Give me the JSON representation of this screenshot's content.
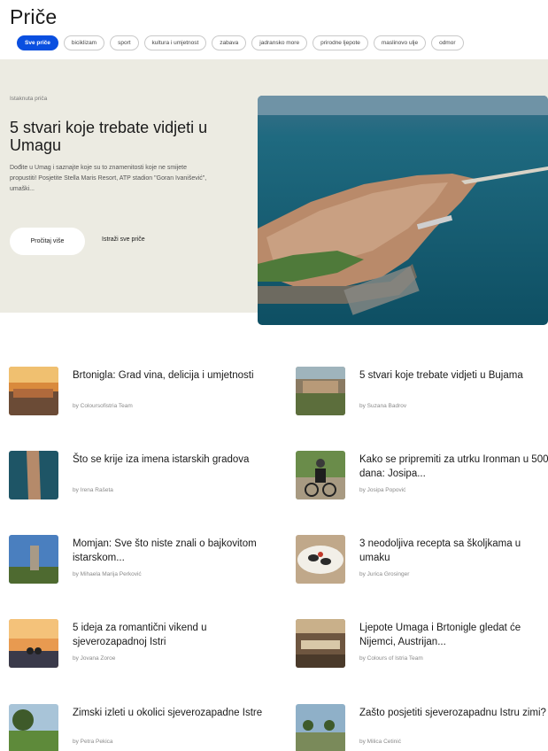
{
  "page": {
    "title": "Priče"
  },
  "filters": [
    {
      "label": "Sve priče",
      "active": true
    },
    {
      "label": "biciklizam",
      "active": false
    },
    {
      "label": "sport",
      "active": false
    },
    {
      "label": "kultura i umjetnost",
      "active": false
    },
    {
      "label": "zabava",
      "active": false
    },
    {
      "label": "jadransko more",
      "active": false
    },
    {
      "label": "prirodne ljepote",
      "active": false
    },
    {
      "label": "maslinovo ulje",
      "active": false
    },
    {
      "label": "odmor",
      "active": false
    }
  ],
  "featured": {
    "kicker": "Istaknuta priča",
    "title": "5 stvari koje trebate vidjeti u Umagu",
    "description": "Dođite u Umag i saznajte koje su to znamenitosti koje ne smijete propustiti! Posjetite Stella Maris Resort, ATP stadion \"Goran Ivanišević\", umaški...",
    "read_more": "Pročitaj više",
    "explore_all": "Istraži sve priče"
  },
  "stories": [
    {
      "title": "Brtonigla: Grad vina, delicija i umjetnosti",
      "author": "by Coloursofistria Team",
      "thumb": "sunset-town"
    },
    {
      "title": "5 stvari koje trebate vidjeti u Bujama",
      "author": "by Suzana Badrov",
      "thumb": "aerial-town"
    },
    {
      "title": "Što se krije iza imena istarskih gradova",
      "author": "by Irena Rašeta",
      "thumb": "aerial-peninsula"
    },
    {
      "title": "Kako se pripremiti za utrku Ironman u 500 dana: Josipa...",
      "author": "by Josipa Popović",
      "thumb": "cyclist"
    },
    {
      "title": "Momjan: Sve što niste znali o bajkovitom istarskom...",
      "author": "by Mihaela Marija Perković",
      "thumb": "tower"
    },
    {
      "title": "3 neodoljiva recepta sa školjkama u umaku",
      "author": "by Jurica Grosinger",
      "thumb": "mussels"
    },
    {
      "title": "5 ideja za romantični vikend u sjeverozapadnoj Istri",
      "author": "by Jovana Zoroe",
      "thumb": "couple-sunset"
    },
    {
      "title": "Ljepote Umaga i Brtonigle gledat će Nijemci, Austrijan...",
      "author": "by Colours of Istria Team",
      "thumb": "interior"
    },
    {
      "title": "Zimski izleti u okolici sjeverozapadne Istre",
      "author": "by Petra Pekica",
      "thumb": "tree-field"
    },
    {
      "title": "Zašto posjetiti sjeverozapadnu Istru zimi?",
      "author": "by Milica Cetinić",
      "thumb": "coast-trees"
    }
  ]
}
